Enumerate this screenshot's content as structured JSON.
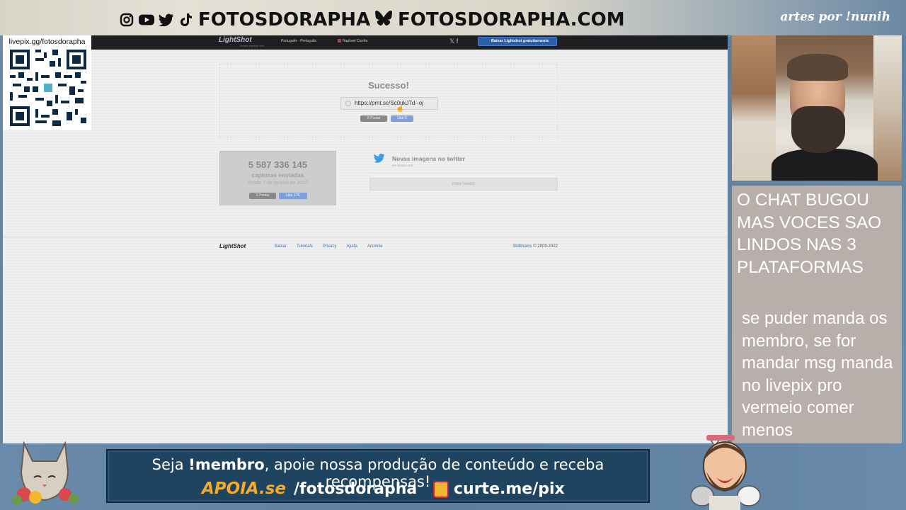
{
  "overlay": {
    "socials_handle": "FOTOSDORAPHA",
    "site": "FOTOSDORAPHA.COM",
    "credit": "artes por !nunih",
    "qr_url": "livepix.gg/fotosdorapha",
    "chat_note_main": "O CHAT BUGOU MAS VOCES SAO LINDOS NAS 3 PLATAFORMAS",
    "chat_note_sub": "se puder manda os membro, se for mandar msg manda no livepix pro vermeio comer menos",
    "banner_line1_prefix": "Seja ",
    "banner_line1_bold": "!membro",
    "banner_line1_rest": ", apoie nossa produção de conteúdo e receba recompensas!",
    "apoia_logo": "APOIA.se",
    "apoia_path": "/fotosdorapha",
    "pix": "curte.me/pix"
  },
  "lightshot": {
    "logo": "LightShot",
    "logo_sub": "screen capture tool",
    "language": "Português - Português",
    "user": "Raphael Corrêa",
    "social_icons": "𝕏  f",
    "download_button": "Baixar Lightshot gratuitamente",
    "success_title": "Sucesso!",
    "share_url": "https://prnt.sc/Sc0ukJ7d--oj",
    "tweet_button": "X Postar",
    "like_button": "Like 0",
    "stats_count": "5 587 336 145",
    "stats_label": "capturas enviadas",
    "stats_since": "desde 7 de janeiro de 2010",
    "stats_tweet": "X Postar",
    "stats_like": "Like 17K",
    "twitter_title": "Novas imagens no twitter",
    "twitter_sub": "em tempo real",
    "more_tweets": "more tweets",
    "footer_logo": "LightShot",
    "footer_links": [
      "Baixar",
      "Tutorials",
      "Privacy",
      "Ajuda",
      "Anuncie"
    ],
    "footer_brand": "Skillbrains",
    "footer_years": " © 2009-2022"
  },
  "colors": {
    "banner_bg": "#1e4460",
    "apoia_orange": "#f4a92f",
    "note_bg": "#b8aeaa",
    "lightshot_link": "#3d6fb0"
  }
}
